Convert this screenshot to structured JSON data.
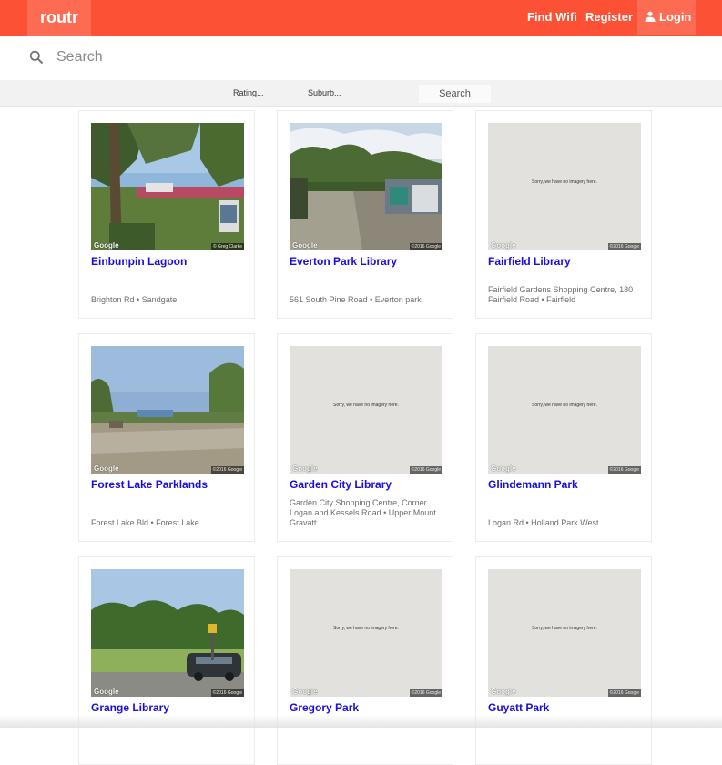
{
  "header": {
    "logo": "routr",
    "nav": {
      "find_wifi": "Find Wifi",
      "register": "Register",
      "login": "Login"
    }
  },
  "search": {
    "placeholder": "Search",
    "value": ""
  },
  "filters": {
    "rating": "Rating...",
    "suburb": "Suburb...",
    "search_button": "Search"
  },
  "colors": {
    "brand": "#fc5135",
    "brand_light": "#fd6b53",
    "title_link": "#1a0de0"
  },
  "icons": {
    "search": "search-icon",
    "user": "user-icon"
  },
  "no_imagery_text": "Sorry, we have no imagery here.",
  "imagery_brand": "Google",
  "imagery_copyright": "©2016 Google",
  "places": [
    {
      "name": "Einbunpin Lagoon",
      "address": "Brighton Rd • Sandgate",
      "copyright": "© Greg Clarke"
    },
    {
      "name": "Everton Park Library",
      "address": "561 South Pine Road • Everton park",
      "copyright": "©2016 Google"
    },
    {
      "name": "Fairfield Library",
      "address": "Fairfield Gardens Shopping Centre, 180 Fairfield Road • Fairfield",
      "copyright": "©2016 Google"
    },
    {
      "name": "Forest Lake Parklands",
      "address": "Forest Lake Bld • Forest Lake",
      "copyright": "©2016 Google"
    },
    {
      "name": "Garden City Library",
      "address": "Garden City Shopping Centre, Corner Logan and Kessels Road • Upper Mount Gravatt",
      "copyright": "©2016 Google"
    },
    {
      "name": "Glindemann Park",
      "address": "Logan Rd • Holland Park West",
      "copyright": "©2016 Google"
    },
    {
      "name": "Grange Library",
      "address": "",
      "copyright": "©2016 Google"
    },
    {
      "name": "Gregory Park",
      "address": "",
      "copyright": "©2016 Google"
    },
    {
      "name": "Guyatt Park",
      "address": "",
      "copyright": "©2016 Google"
    }
  ]
}
